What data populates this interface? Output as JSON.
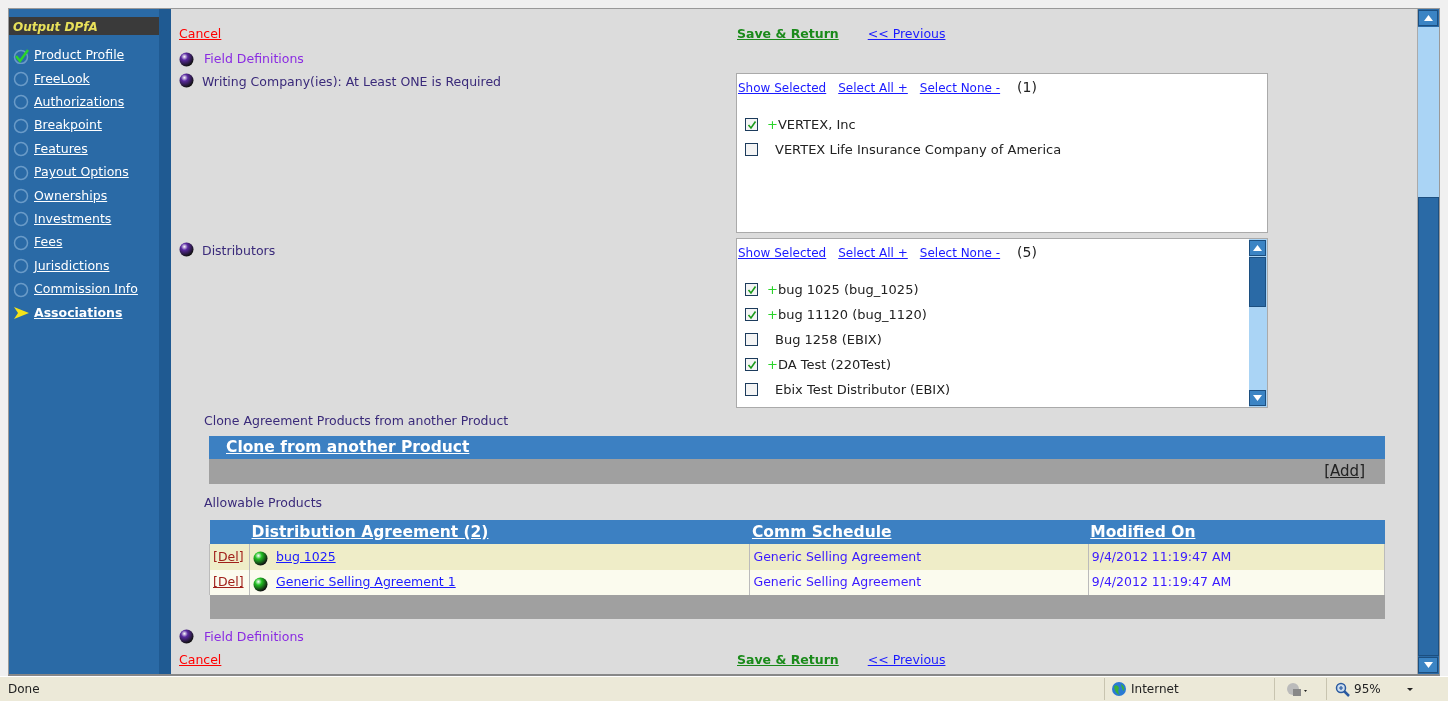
{
  "sidebar": {
    "title": "Output DPfA",
    "items": [
      {
        "label": "Product Profile",
        "completed": true,
        "selected": false
      },
      {
        "label": "FreeLook",
        "completed": false,
        "selected": false
      },
      {
        "label": "Authorizations",
        "completed": false,
        "selected": false
      },
      {
        "label": "Breakpoint",
        "completed": false,
        "selected": false
      },
      {
        "label": "Features",
        "completed": false,
        "selected": false
      },
      {
        "label": "Payout Options",
        "completed": false,
        "selected": false
      },
      {
        "label": "Ownerships",
        "completed": false,
        "selected": false
      },
      {
        "label": "Investments",
        "completed": false,
        "selected": false
      },
      {
        "label": "Fees",
        "completed": false,
        "selected": false
      },
      {
        "label": "Jurisdictions",
        "completed": false,
        "selected": false
      },
      {
        "label": "Commission Info",
        "completed": false,
        "selected": false
      },
      {
        "label": "Associations",
        "selected": true
      }
    ]
  },
  "top_actions": {
    "cancel": "Cancel",
    "save": "Save & Return",
    "previous": "<< Previous"
  },
  "field_definitions_top": "Field Definitions",
  "writing_companies": {
    "label": "Writing Company(ies): At Least ONE is Required",
    "links": [
      "Show Selected",
      "Select All +",
      "Select None -"
    ],
    "count": "(1)",
    "items": [
      {
        "prefix": "+",
        "label": "VERTEX, Inc",
        "checked": true
      },
      {
        "label": "VERTEX Life Insurance Company of America",
        "checked": false
      }
    ]
  },
  "distributors": {
    "label": "Distributors",
    "links": [
      "Show Selected",
      "Select All +",
      "Select None -"
    ],
    "count": "(5)",
    "items": [
      {
        "prefix": "+",
        "label": "bug 1025 (bug_1025)",
        "checked": true
      },
      {
        "prefix": "+",
        "label": "bug 11120 (bug_1120)",
        "checked": true
      },
      {
        "label": "Bug 1258 (EBIX)",
        "checked": false
      },
      {
        "prefix": "+",
        "label": "DA Test (220Test)",
        "checked": true
      },
      {
        "label": "Ebix Test Distributor (EBIX)",
        "checked": false
      }
    ]
  },
  "clone": {
    "label": "Clone Agreement Products from another Product",
    "header": "Clone from another Product",
    "add": "[Add]"
  },
  "allowable_products": {
    "label": "Allowable Products",
    "columns": [
      "Distribution Agreement (2)",
      "Comm Schedule",
      "Modified On"
    ],
    "rows": [
      {
        "action": "[Del]",
        "agreement": "bug 1025",
        "schedule": "Generic Selling Agreement",
        "modified": "9/4/2012 11:19:47 AM"
      },
      {
        "action": "[Del]",
        "agreement": "Generic Selling Agreement 1",
        "schedule": "Generic Selling Agreement",
        "modified": "9/4/2012 11:19:47 AM"
      }
    ]
  },
  "field_definitions_bottom": "Field Definitions",
  "bottom_actions": {
    "cancel": "Cancel",
    "save": "Save & Return",
    "previous": "<< Previous"
  },
  "status_bar": {
    "status": "Done",
    "zone": "Internet",
    "zoom": "95%"
  }
}
